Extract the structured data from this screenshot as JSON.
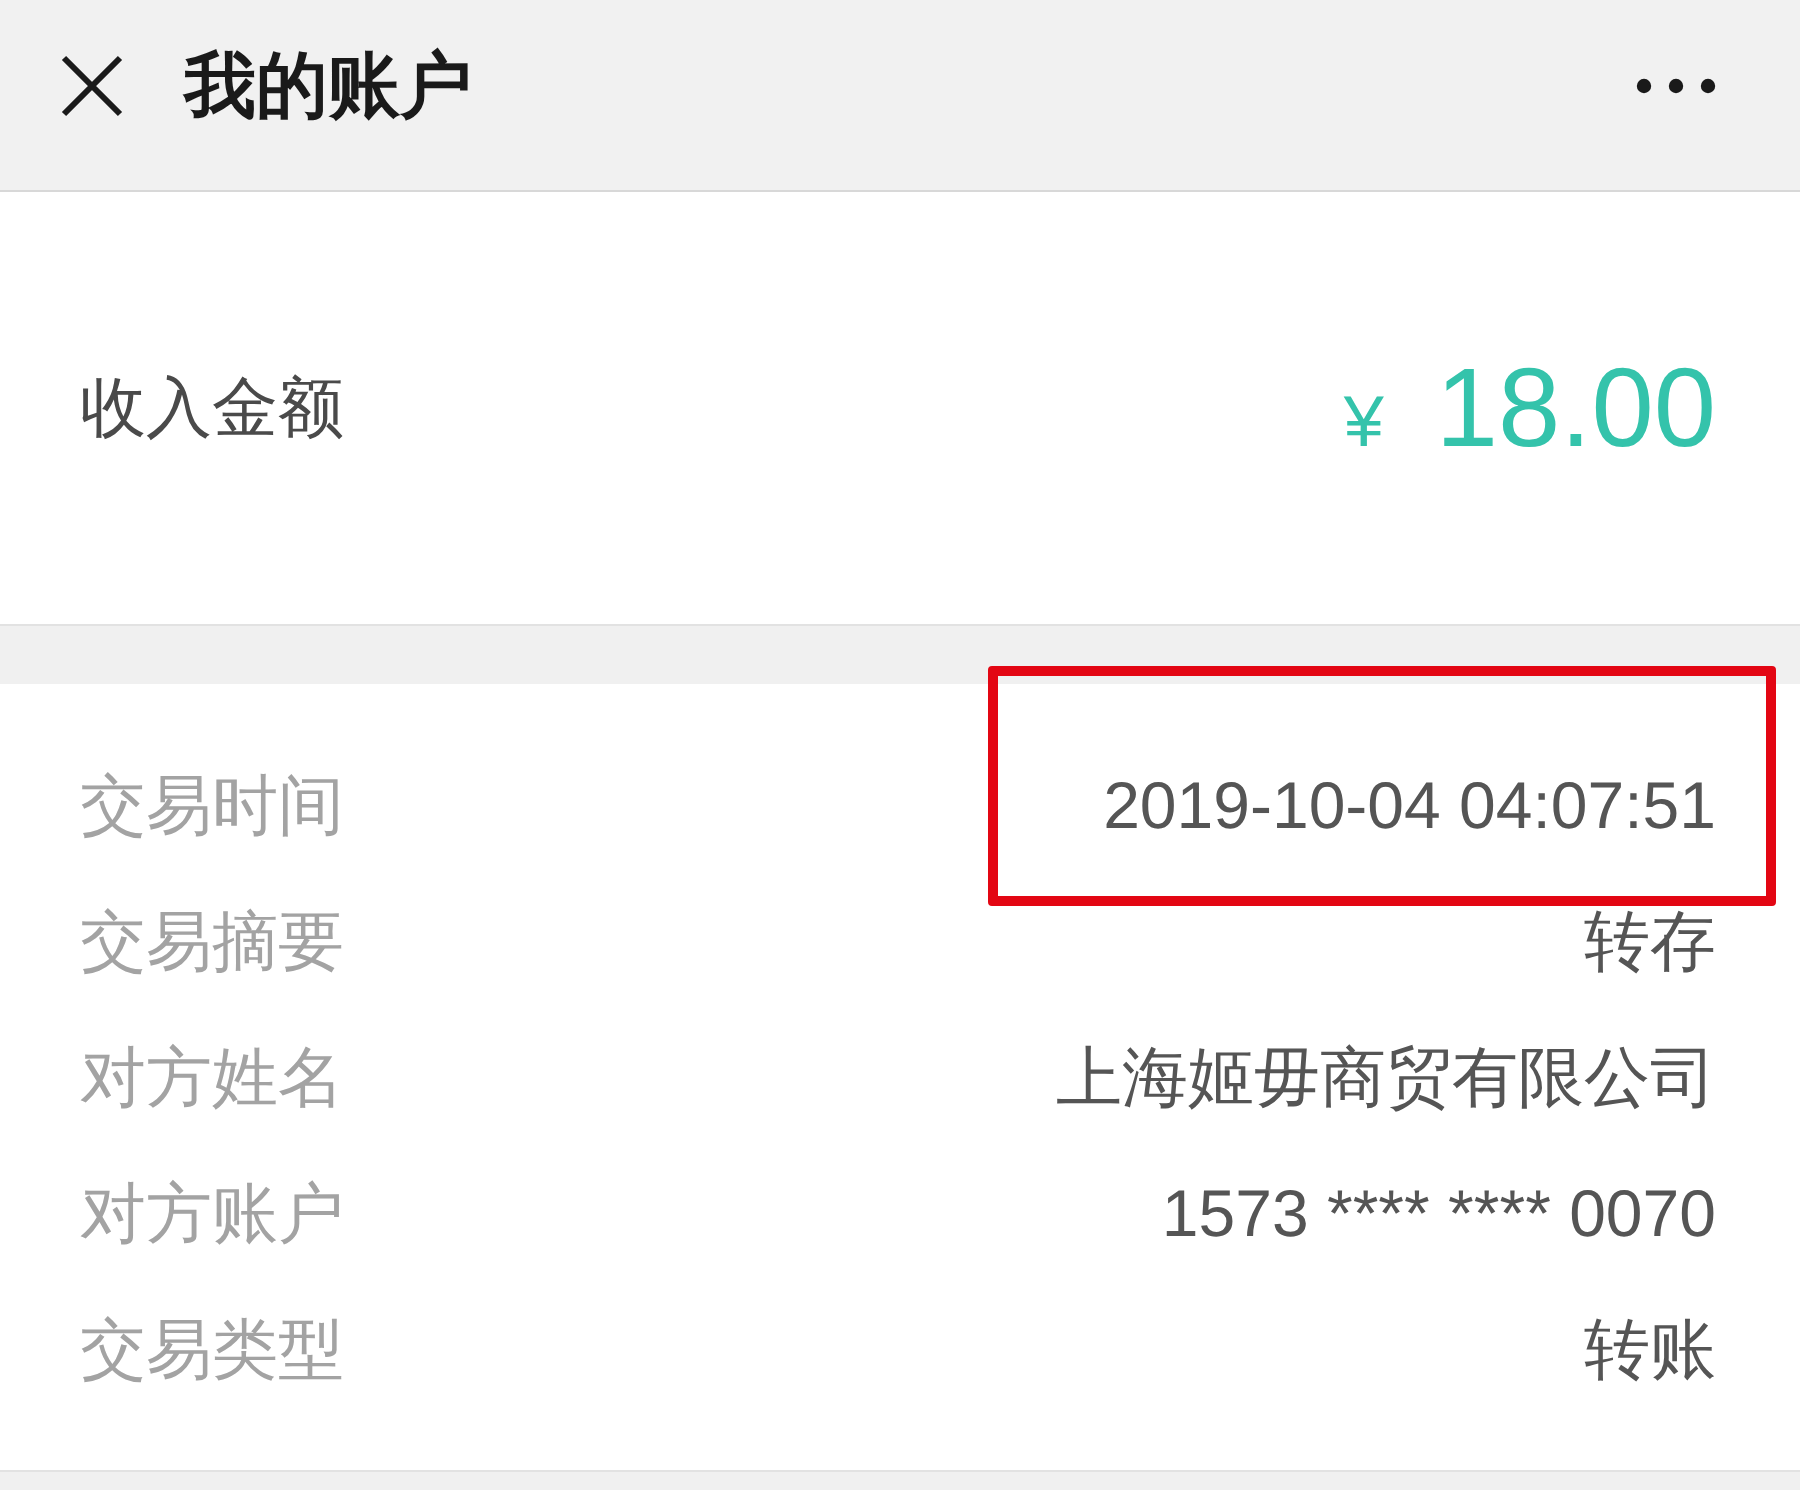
{
  "header": {
    "title": "我的账户"
  },
  "amount": {
    "label": "收入金额",
    "currency": "¥",
    "value": "18.00"
  },
  "details": [
    {
      "label": "交易时间",
      "value": "2019-10-04 04:07:51",
      "highlighted": true
    },
    {
      "label": "交易摘要",
      "value": "转存",
      "highlighted": false
    },
    {
      "label": "对方姓名",
      "value": "上海姬毋商贸有限公司",
      "highlighted": false
    },
    {
      "label": "对方账户",
      "value": "1573 **** **** 0070",
      "highlighted": false
    },
    {
      "label": "交易类型",
      "value": "转账",
      "highlighted": false
    }
  ]
}
